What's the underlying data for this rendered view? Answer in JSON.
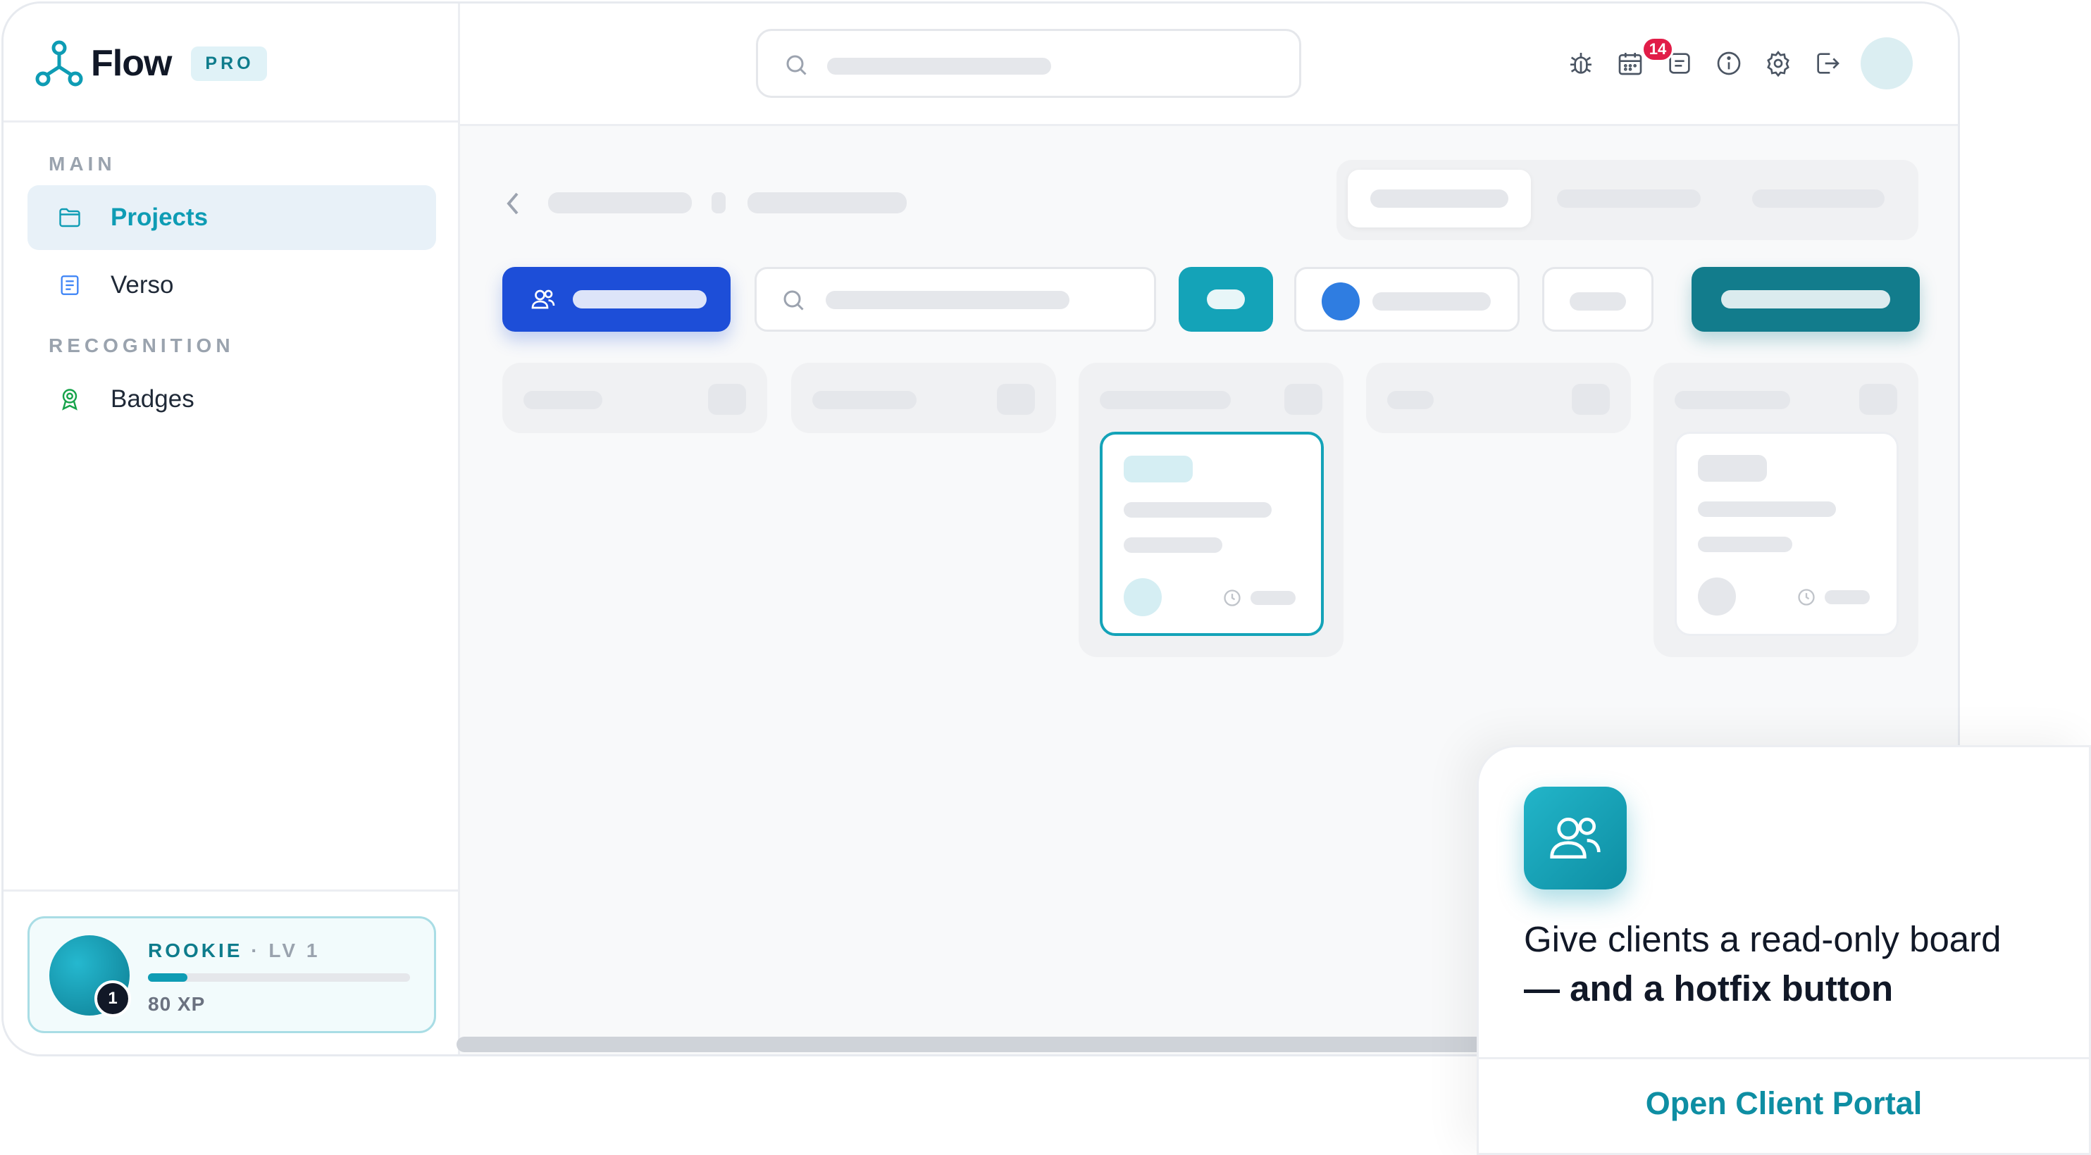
{
  "brand": {
    "name": "Flow",
    "tier": "PRO"
  },
  "sidebar": {
    "sections": [
      "MAIN",
      "RECOGNITION"
    ],
    "items": [
      {
        "label": "Projects"
      },
      {
        "label": "Verso"
      },
      {
        "label": "Badges"
      }
    ]
  },
  "rank": {
    "title": "ROOKIE",
    "level_text": "· LV 1",
    "level_number": "1",
    "xp": "80 XP",
    "progress": 0.15
  },
  "topbar": {
    "notification_count": "14"
  },
  "promo": {
    "text_regular": "Give clients a read-only board",
    "text_bold": "— and a hotfix button",
    "link": "Open Client Portal"
  },
  "colors": {
    "accent": "#0e9cb4",
    "primary": "#1d4ed8",
    "badge": "#e11d48"
  }
}
